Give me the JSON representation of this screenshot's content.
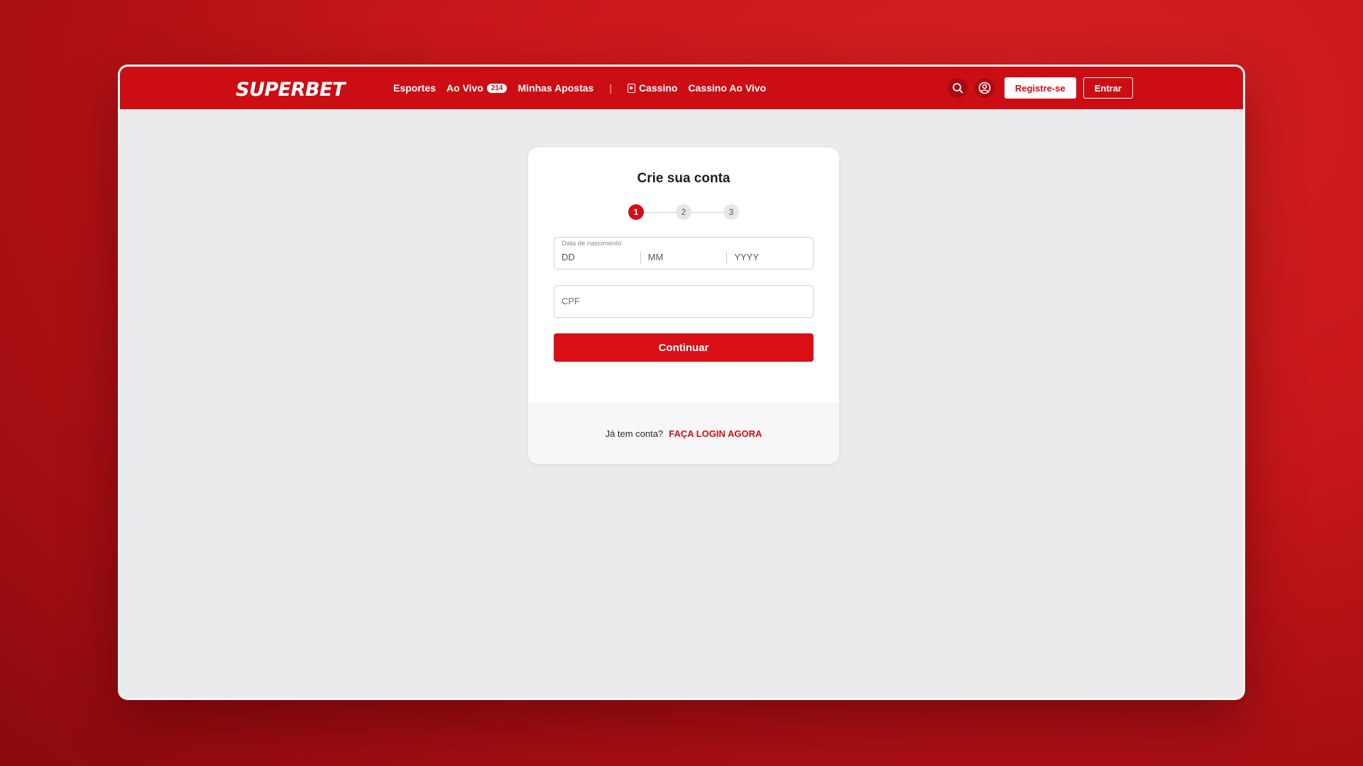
{
  "header": {
    "logo_text": "SUPERBET",
    "nav": [
      {
        "label": "Esportes"
      },
      {
        "label": "Ao Vivo",
        "badge": "214"
      },
      {
        "label": "Minhas Apostas"
      },
      {
        "label": "Cassino",
        "icon": "cassino-icon"
      },
      {
        "label": "Cassino Ao Vivo"
      }
    ],
    "separator": "|",
    "register_label": "Registre-se",
    "login_label": "Entrar",
    "brand_color": "#cc0e14"
  },
  "signup": {
    "title": "Crie sua conta",
    "steps": [
      "1",
      "2",
      "3"
    ],
    "active_step": 1,
    "birthdate": {
      "label": "Data de nascimento",
      "day_placeholder": "DD",
      "month_placeholder": "MM",
      "year_placeholder": "YYYY"
    },
    "cpf_placeholder": "CPF",
    "continue_label": "Continuar",
    "footer_text": "Já tem conta?",
    "footer_link": "FAÇA LOGIN AGORA"
  }
}
